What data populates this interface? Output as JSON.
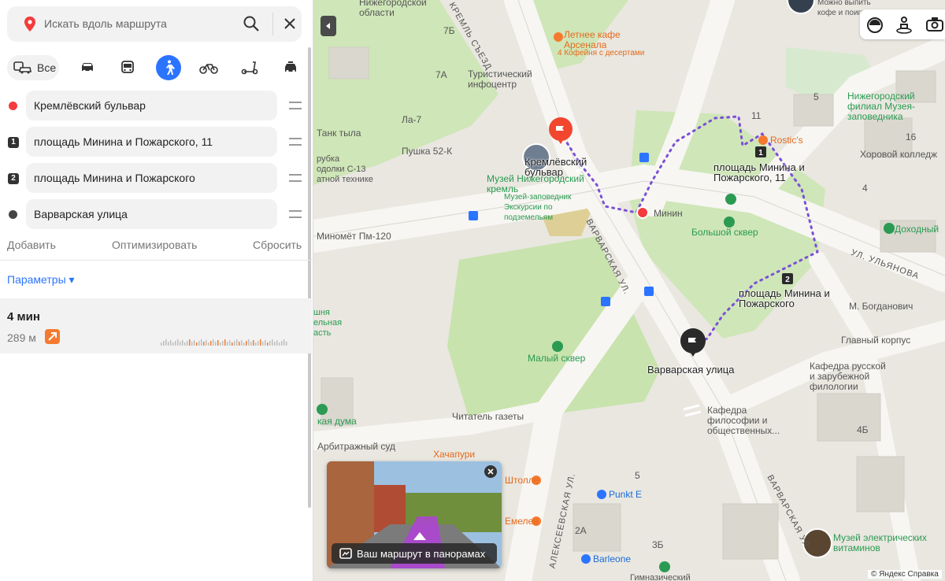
{
  "search": {
    "placeholder": "Искать вдоль маршрута",
    "icon": "map-pin-icon"
  },
  "modes": [
    {
      "id": "all",
      "label": "Все",
      "icon": "all-transport-icon"
    },
    {
      "id": "car",
      "icon": "car-icon"
    },
    {
      "id": "bus",
      "icon": "bus-icon"
    },
    {
      "id": "walk",
      "icon": "pedestrian-icon",
      "active": true
    },
    {
      "id": "bike",
      "icon": "bicycle-icon"
    },
    {
      "id": "scooter",
      "icon": "scooter-icon"
    },
    {
      "id": "taxi",
      "icon": "taxi-icon"
    }
  ],
  "waypoints": [
    {
      "marker": "start-dot",
      "color": "#f43b3b",
      "label": "Кремлёвский бульвар"
    },
    {
      "marker": "1",
      "label": "площадь Минина и Пожарского, 11"
    },
    {
      "marker": "2",
      "label": "площадь Минина и Пожарского"
    },
    {
      "marker": "end-dot",
      "color": "#444444",
      "label": "Варварская улица"
    }
  ],
  "actions": {
    "add": "Добавить",
    "optimize": "Оптимизировать",
    "reset": "Сбросить"
  },
  "params_label": "Параметры ▾",
  "route": {
    "time": "4 мин",
    "distance": "289 м",
    "accent": "#f57a2f"
  },
  "accent_color": "#2b74ff",
  "map": {
    "labels": {
      "oblast": "Нижегородской\nобласти",
      "letnee": "Летнее кафе\nАрсенала",
      "kofeinya": "4 Кофейня с десертами",
      "turist": "Туристический\nинфоцентр",
      "la7": "Ла-7",
      "pushka": "Пушка 52-К",
      "tanktyla": "Танк тыла",
      "trubka": "рубка\nодолки С-13\nатной технике",
      "minomet": "Миномёт Пм-120",
      "kremlbul": "Кремлёвский\nбульвар",
      "muzei": "Музей Нижегородский\nкремль",
      "muzei_sub": "Музей-заповедник\nЭкскурсии по\nподземельям",
      "minin": "Минин",
      "bolshoi": "Большой сквер",
      "pl11": "площадь Минина и\nПожарского, 11",
      "pl": "площадь Минина и\nПожарского",
      "rostics": "Rostic's",
      "nizhfil": "Нижегородский\nфилиал Музея-\nзаповедника",
      "horovoi": "Хоровой колледж",
      "dohodny": "Доходный",
      "ulyanova": "УЛ. УЛЬЯНОВА",
      "bogdanovich": "М. Богданович",
      "glavny": "Главный корпус",
      "kafedra": "Кафедра русской\nи зарубежной\nфилологии",
      "kafedra2": "Кафедра\nфилософии и\nобщественных...",
      "varvarskaya_pt": "Варварская улица",
      "maly": "Малый сквер",
      "chitatel": "Читатель газеты",
      "arbitr": "Арбитражный суд",
      "duma": "кая дума",
      "hachapuri": "Хачапури",
      "shtolle": "Штолле",
      "emelev": "Емелев",
      "punkte": "Punkt E",
      "barleone": "Barleone",
      "gimnaz": "Гимназический",
      "muzeielek": "Музей электрических\nвитаминов",
      "shna": "шня\nельная\nасть",
      "vydpit": "Можно выпить\nкофе и поигра",
      "varv_street": "ВАРВАРСКАЯ УЛ.",
      "varv_street2": "ВАРВАРСКАЯ УЛ.",
      "alekseevskaya": "АЛЕКСЕЕВСКАЯ УЛ.",
      "kremlsezd": "КРЕМЛЬ СЪЕЗД",
      "b5": "5",
      "b4": "4",
      "b4b": "4Б",
      "b7a": "7А",
      "b7b": "7Б",
      "b11": "11",
      "b16": "16",
      "b3b": "3Б",
      "b2a": "2А",
      "b5b": "5"
    },
    "pano_caption": "Ваш маршрут в панорамах",
    "copyright": "© Яндекс  Справка"
  }
}
